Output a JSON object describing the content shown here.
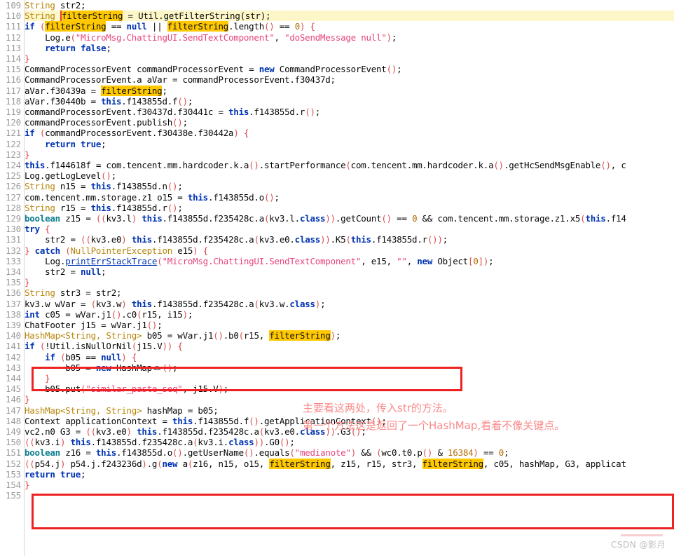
{
  "app": {
    "kind": "decompiled-java-source-view",
    "highlighted_symbol": "filterString",
    "current_line": 110,
    "first_line": 109,
    "last_line": 155
  },
  "colors": {
    "keyword": "#0033b3",
    "type": "#b8860b",
    "string": "#e8447f",
    "punctuation": "#d94f4f",
    "occurrence_highlight": "#ffc800",
    "caret_row_highlight": "#fdf6c8",
    "annotation_box": "#ee2222",
    "annotation_text": "#fa8a8a",
    "gutter_text": "#9a9a9a",
    "background": "#ffffff"
  },
  "gutter": {
    "numbers": [
      "109",
      "110",
      "111",
      "112",
      "113",
      "114",
      "115",
      "116",
      "117",
      "118",
      "119",
      "120",
      "121",
      "122",
      "123",
      "124",
      "125",
      "126",
      "127",
      "128",
      "129",
      "130",
      "131",
      "132",
      "133",
      "134",
      "135",
      "136",
      "137",
      "138",
      "139",
      "140",
      "141",
      "142",
      "143",
      "144",
      "145",
      "146",
      "147",
      "148",
      "149",
      "150",
      "151",
      "152",
      "153",
      "154",
      "155"
    ]
  },
  "code_lines": [
    {
      "n": 109,
      "text": "        String str2;"
    },
    {
      "n": 110,
      "text": "        String filterString = Util.getFilterString(str);"
    },
    {
      "n": 111,
      "text": "        if (filterString == null || filterString.length() == 0) {"
    },
    {
      "n": 112,
      "text": "            Log.e(\"MicroMsg.ChattingUI.SendTextComponent\", \"doSendMessage null\");"
    },
    {
      "n": 113,
      "text": "            return false;"
    },
    {
      "n": 114,
      "text": "        }"
    },
    {
      "n": 115,
      "text": "        CommandProcessorEvent commandProcessorEvent = new CommandProcessorEvent();"
    },
    {
      "n": 116,
      "text": "        CommandProcessorEvent.a aVar = commandProcessorEvent.f30437d;"
    },
    {
      "n": 117,
      "text": "        aVar.f30439a = filterString;"
    },
    {
      "n": 118,
      "text": "        aVar.f30440b = this.f143855d.f();"
    },
    {
      "n": 119,
      "text": "        commandProcessorEvent.f30437d.f30441c = this.f143855d.r();"
    },
    {
      "n": 120,
      "text": "        commandProcessorEvent.publish();"
    },
    {
      "n": 121,
      "text": "        if (commandProcessorEvent.f30438e.f30442a) {"
    },
    {
      "n": 122,
      "text": "            return true;"
    },
    {
      "n": 123,
      "text": "        }"
    },
    {
      "n": 124,
      "text": "        this.f144618f = com.tencent.mm.hardcoder.k.a().startPerformance(com.tencent.mm.hardcoder.k.a().getHcSendMsgEnable(), c"
    },
    {
      "n": 125,
      "text": "        Log.getLogLevel();"
    },
    {
      "n": 126,
      "text": "        String n15 = this.f143855d.n();"
    },
    {
      "n": 127,
      "text": "        com.tencent.mm.storage.z1 o15 = this.f143855d.o();"
    },
    {
      "n": 128,
      "text": "        String r15 = this.f143855d.r();"
    },
    {
      "n": 129,
      "text": "        boolean z15 = ((kv3.l) this.f143855d.f235428c.a(kv3.l.class)).getCount() == 0 && com.tencent.mm.storage.z1.x5(this.f14"
    },
    {
      "n": 130,
      "text": "        try {"
    },
    {
      "n": 131,
      "text": "            str2 = ((kv3.e0) this.f143855d.f235428c.a(kv3.e0.class)).K5(this.f143855d.r());"
    },
    {
      "n": 132,
      "text": "        } catch (NullPointerException e15) {"
    },
    {
      "n": 133,
      "text": "            Log.printErrStackTrace(\"MicroMsg.ChattingUI.SendTextComponent\", e15, \"\", new Object[0]);"
    },
    {
      "n": 134,
      "text": "            str2 = null;"
    },
    {
      "n": 135,
      "text": "        }"
    },
    {
      "n": 136,
      "text": "        String str3 = str2;"
    },
    {
      "n": 137,
      "text": "        kv3.w wVar = (kv3.w) this.f143855d.f235428c.a(kv3.w.class);"
    },
    {
      "n": 138,
      "text": "        int c05 = wVar.j1().c0(r15, i15);"
    },
    {
      "n": 139,
      "text": "        ChatFooter j15 = wVar.j1();"
    },
    {
      "n": 140,
      "text": "        HashMap<String, String> b05 = wVar.j1().b0(r15, filterString);"
    },
    {
      "n": 141,
      "text": "        if (!Util.isNullOrNil(j15.V)) {"
    },
    {
      "n": 142,
      "text": "            if (b05 == null) {"
    },
    {
      "n": 143,
      "text": "                b05 = new HashMap<>();"
    },
    {
      "n": 144,
      "text": "            }"
    },
    {
      "n": 145,
      "text": "            b05.put(\"similar_paste_seq\", j15.V);"
    },
    {
      "n": 146,
      "text": "        }"
    },
    {
      "n": 147,
      "text": "        HashMap<String, String> hashMap = b05;"
    },
    {
      "n": 148,
      "text": "        Context applicationContext = this.f143855d.f().getApplicationContext();"
    },
    {
      "n": 149,
      "text": "        vc2.n0 G3 = ((kv3.e0) this.f143855d.f235428c.a(kv3.e0.class)).G3();"
    },
    {
      "n": 150,
      "text": "        ((kv3.i) this.f143855d.f235428c.a(kv3.i.class)).G0();"
    },
    {
      "n": 151,
      "text": "        boolean z16 = this.f143855d.o().getUserName().equals(\"medianote\") && (wc0.t0.p() & 16384) == 0;"
    },
    {
      "n": 152,
      "text": "        ((p54.j) p54.j.f243236d).g(new a(z16, n15, o15, filterString, z15, r15, str3, filterString, c05, hashMap, G3, applicat"
    },
    {
      "n": 153,
      "text": "        return true;"
    },
    {
      "n": 154,
      "text": "    }"
    },
    {
      "n": 155,
      "text": ""
    }
  ],
  "annotations": {
    "boxes": [
      {
        "id": "box-hashmap-call",
        "label": "red-box-around-hashmap-b0-call",
        "lines": [
          140,
          141
        ]
      },
      {
        "id": "box-send-call",
        "label": "red-box-around-p54j-g-call",
        "lines": [
          151,
          153
        ]
      }
    ],
    "notes": [
      {
        "id": "note-1",
        "text": "主要看这两处，传入str的方法。"
      },
      {
        "id": "note-2",
        "text": "第一个方法这是返回了一个HashMap,看着不像关键点。"
      }
    ]
  },
  "watermark": {
    "text": "CSDN @影月"
  }
}
